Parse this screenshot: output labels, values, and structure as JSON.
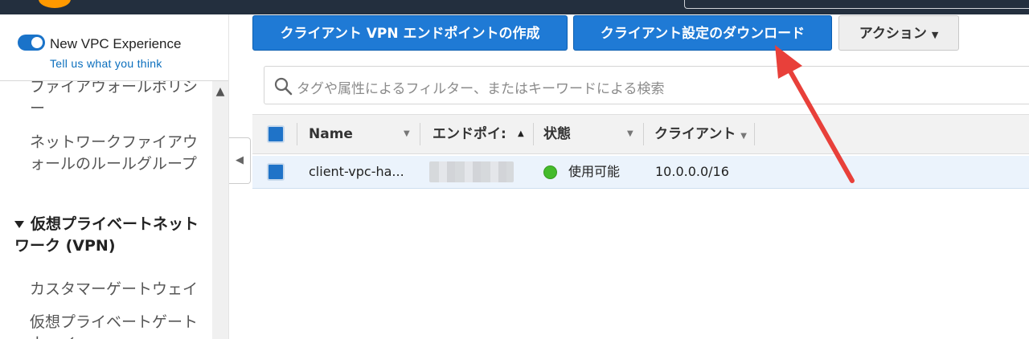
{
  "sidebar": {
    "toggle_label": "New VPC Experience",
    "feedback_link": "Tell us what you think",
    "items": [
      {
        "label": "ファイアウォールポリシー"
      },
      {
        "label": "ネットワークファイアウォールのルールグループ"
      }
    ],
    "section": {
      "label": "仮想プライベートネットワーク (VPN)"
    },
    "section_items": [
      {
        "label": "カスタマーゲートウェイ"
      },
      {
        "label": "仮想プライベートゲートウェイ"
      }
    ]
  },
  "toolbar": {
    "create_label": "クライアント VPN エンドポイントの作成",
    "download_label": "クライアント設定のダウンロード",
    "actions_label": "アクション"
  },
  "filter": {
    "placeholder": "タグや属性によるフィルター、またはキーワードによる検索"
  },
  "table": {
    "columns": [
      "Name",
      "エンドポイ:",
      "状態",
      "クライアント"
    ],
    "rows": [
      {
        "name": "client-vpc-ha...",
        "endpoint": "",
        "status": "使用可能",
        "client": "10.0.0.0/16"
      }
    ]
  },
  "colors": {
    "primary_button": "#1f7ad5",
    "status_available": "#44bb2b",
    "annotation_arrow": "#e8403a"
  }
}
